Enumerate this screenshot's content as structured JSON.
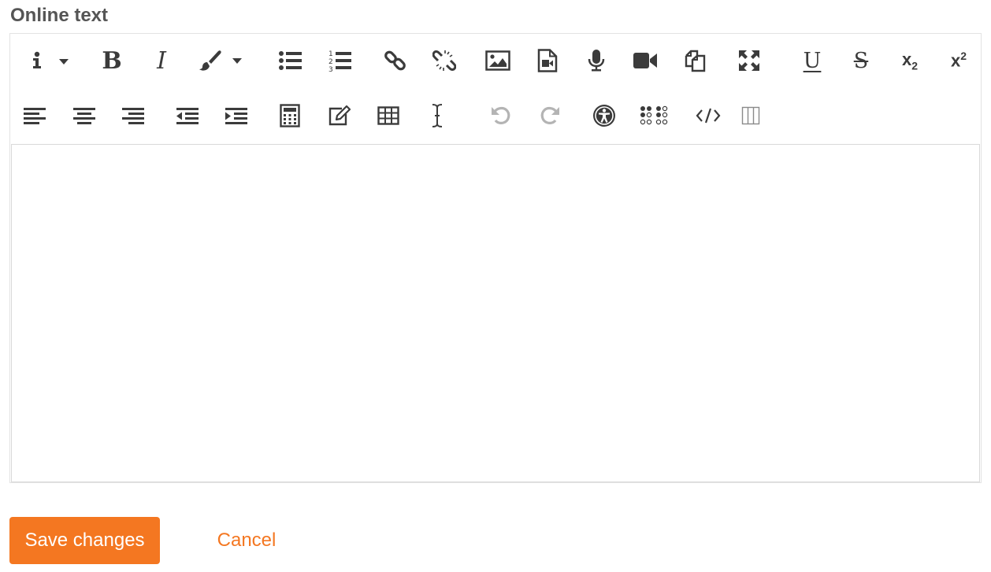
{
  "field": {
    "label": "Online text"
  },
  "toolbar": {
    "row1": [
      "info-dropdown",
      "bold",
      "italic",
      "font-color-dropdown",
      "unordered-list",
      "ordered-list",
      "link",
      "unlink",
      "insert-image",
      "insert-media",
      "record-audio",
      "record-video",
      "paste-special",
      "fullscreen",
      "underline",
      "strikethrough",
      "subscript",
      "superscript"
    ],
    "row2": [
      "align-left",
      "align-center",
      "align-right",
      "outdent",
      "indent",
      "equation-editor",
      "manage-files",
      "table",
      "special-character",
      "undo",
      "redo",
      "accessibility-checker",
      "screenreader-helper",
      "html-source",
      "toggle-columns"
    ],
    "bold_glyph": "B",
    "italic_glyph": "I",
    "underline_glyph": "U",
    "strike_glyph": "S",
    "sub_base": "x",
    "sub_index": "2",
    "sup_base": "x",
    "sup_index": "2"
  },
  "editor": {
    "content": ""
  },
  "actions": {
    "save_label": "Save changes",
    "cancel_label": "Cancel"
  },
  "colors": {
    "accent": "#f47721",
    "icon": "#3b3b3b",
    "icon_disabled": "#b4b4b4",
    "border": "#e3e3e3"
  }
}
